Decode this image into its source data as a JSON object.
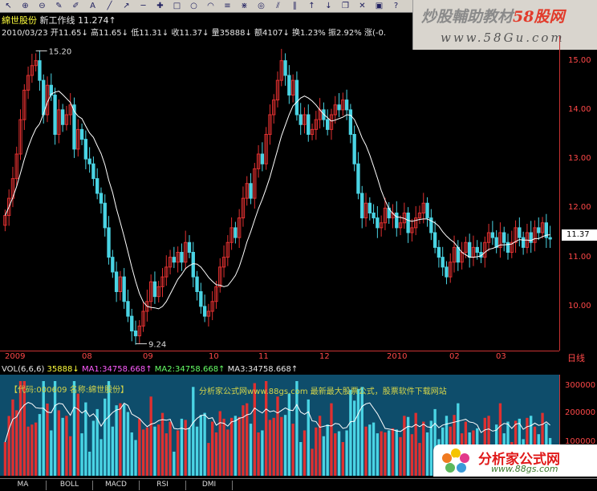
{
  "toolbar_icons": [
    "arrow-icon",
    "zoom-in-icon",
    "zoom-out-icon",
    "pencil-icon",
    "brush-icon",
    "text-icon",
    "line-icon",
    "ray-icon",
    "segment-icon",
    "cross-icon",
    "box-icon",
    "ellipse-icon",
    "arc-icon",
    "fib-icon",
    "gann-icon",
    "cycle-icon",
    "channel-icon",
    "parallel-icon",
    "up-arrow-icon",
    "down-arrow-icon",
    "copy-icon",
    "erase-icon",
    "save-icon",
    "help-icon"
  ],
  "banner": {
    "title_part1": "炒股輔助教材",
    "title_part2": "58股网",
    "url": "www.58Gu.com"
  },
  "stock": {
    "name": "綿世股份",
    "line_label": "新工作线",
    "line_value": "11.274↑"
  },
  "quote": {
    "date": "2010/03/23",
    "open": "开11.65↓",
    "high": "高11.65↓",
    "low": "低11.31↓",
    "close": "收11.37↓",
    "volume": "量35888↓",
    "amount": "额4107↓",
    "turnover": "换1.23%",
    "amplitude": "振2.92%",
    "change": "涨(-0."
  },
  "annotations": {
    "high": "15.20",
    "low": "9.24"
  },
  "price_axis": {
    "ticks": [
      "15.00",
      "14.00",
      "13.00",
      "12.00",
      "11.00",
      "10.00"
    ],
    "current": "11.37"
  },
  "date_axis": {
    "labels": [
      "2009",
      "08",
      "09",
      "10",
      "11",
      "12",
      "2010",
      "02",
      "03"
    ],
    "unit": "日线"
  },
  "volume": {
    "label": "VOL(6,6,6)",
    "value": "35888↓",
    "ma1": "MA1:34758.668↑",
    "ma2": "MA2:34758.668↑",
    "ma3": "MA3:34758.668↑",
    "code": "【代码:000609 名称:綿世股份】",
    "ad": "分析家公式网www.88gs.com 最新最大股票公式，股票软件下载网站",
    "ticks": [
      "300000",
      "200000",
      "100000"
    ]
  },
  "logo": {
    "main": "分析家公式网",
    "url": "www.88gs.com"
  },
  "tabs": [
    "MA",
    "BOLL",
    "MACD",
    "RSI",
    "DMI"
  ],
  "colors": {
    "up": "#e03030",
    "down": "#4ad4e4",
    "ma_line": "#ffffff",
    "axis": "#ff4848",
    "vol_bg": "#0e4d6b"
  },
  "chart_data": {
    "type": "candlestick",
    "ylim": [
      9.1,
      15.5
    ],
    "close": [
      11.85,
      12.2,
      12.6,
      13.1,
      13.8,
      14.4,
      14.7,
      14.9,
      15.0,
      14.6,
      13.9,
      14.5,
      14.3,
      13.5,
      14.0,
      13.7,
      13.9,
      14.1,
      13.2,
      13.6,
      13.4,
      13.0,
      12.9,
      12.6,
      12.3,
      12.1,
      11.6,
      11.0,
      10.7,
      10.3,
      10.6,
      10.1,
      9.8,
      9.5,
      9.4,
      9.6,
      9.9,
      10.1,
      10.5,
      10.2,
      10.4,
      10.6,
      10.8,
      11.0,
      10.9,
      11.1,
      10.9,
      11.3,
      11.1,
      10.6,
      10.3,
      10.0,
      9.8,
      9.9,
      10.1,
      10.4,
      10.8,
      11.0,
      11.3,
      11.6,
      11.4,
      11.8,
      12.2,
      12.5,
      12.2,
      12.8,
      13.1,
      12.9,
      13.5,
      13.9,
      14.2,
      14.6,
      15.0,
      14.7,
      14.3,
      14.6,
      13.9,
      13.7,
      13.9,
      13.5,
      13.6,
      13.8,
      14.0,
      13.8,
      13.6,
      13.9,
      14.1,
      14.0,
      14.2,
      14.0,
      13.5,
      12.9,
      12.3,
      11.8,
      12.1,
      11.9,
      11.8,
      11.6,
      11.7,
      12.0,
      11.8,
      11.9,
      11.6,
      11.7,
      11.9,
      11.5,
      11.6,
      11.8,
      11.9,
      12.1,
      11.8,
      11.5,
      11.2,
      11.0,
      10.8,
      10.6,
      10.9,
      11.2,
      10.9,
      11.1,
      11.3,
      11.0,
      11.2,
      11.1,
      11.0,
      11.3,
      11.5,
      11.4,
      11.2,
      11.5,
      11.3,
      11.1,
      11.3,
      11.6,
      11.4,
      11.2,
      11.5,
      11.3,
      11.6,
      11.5,
      11.7,
      11.4,
      11.37
    ]
  }
}
